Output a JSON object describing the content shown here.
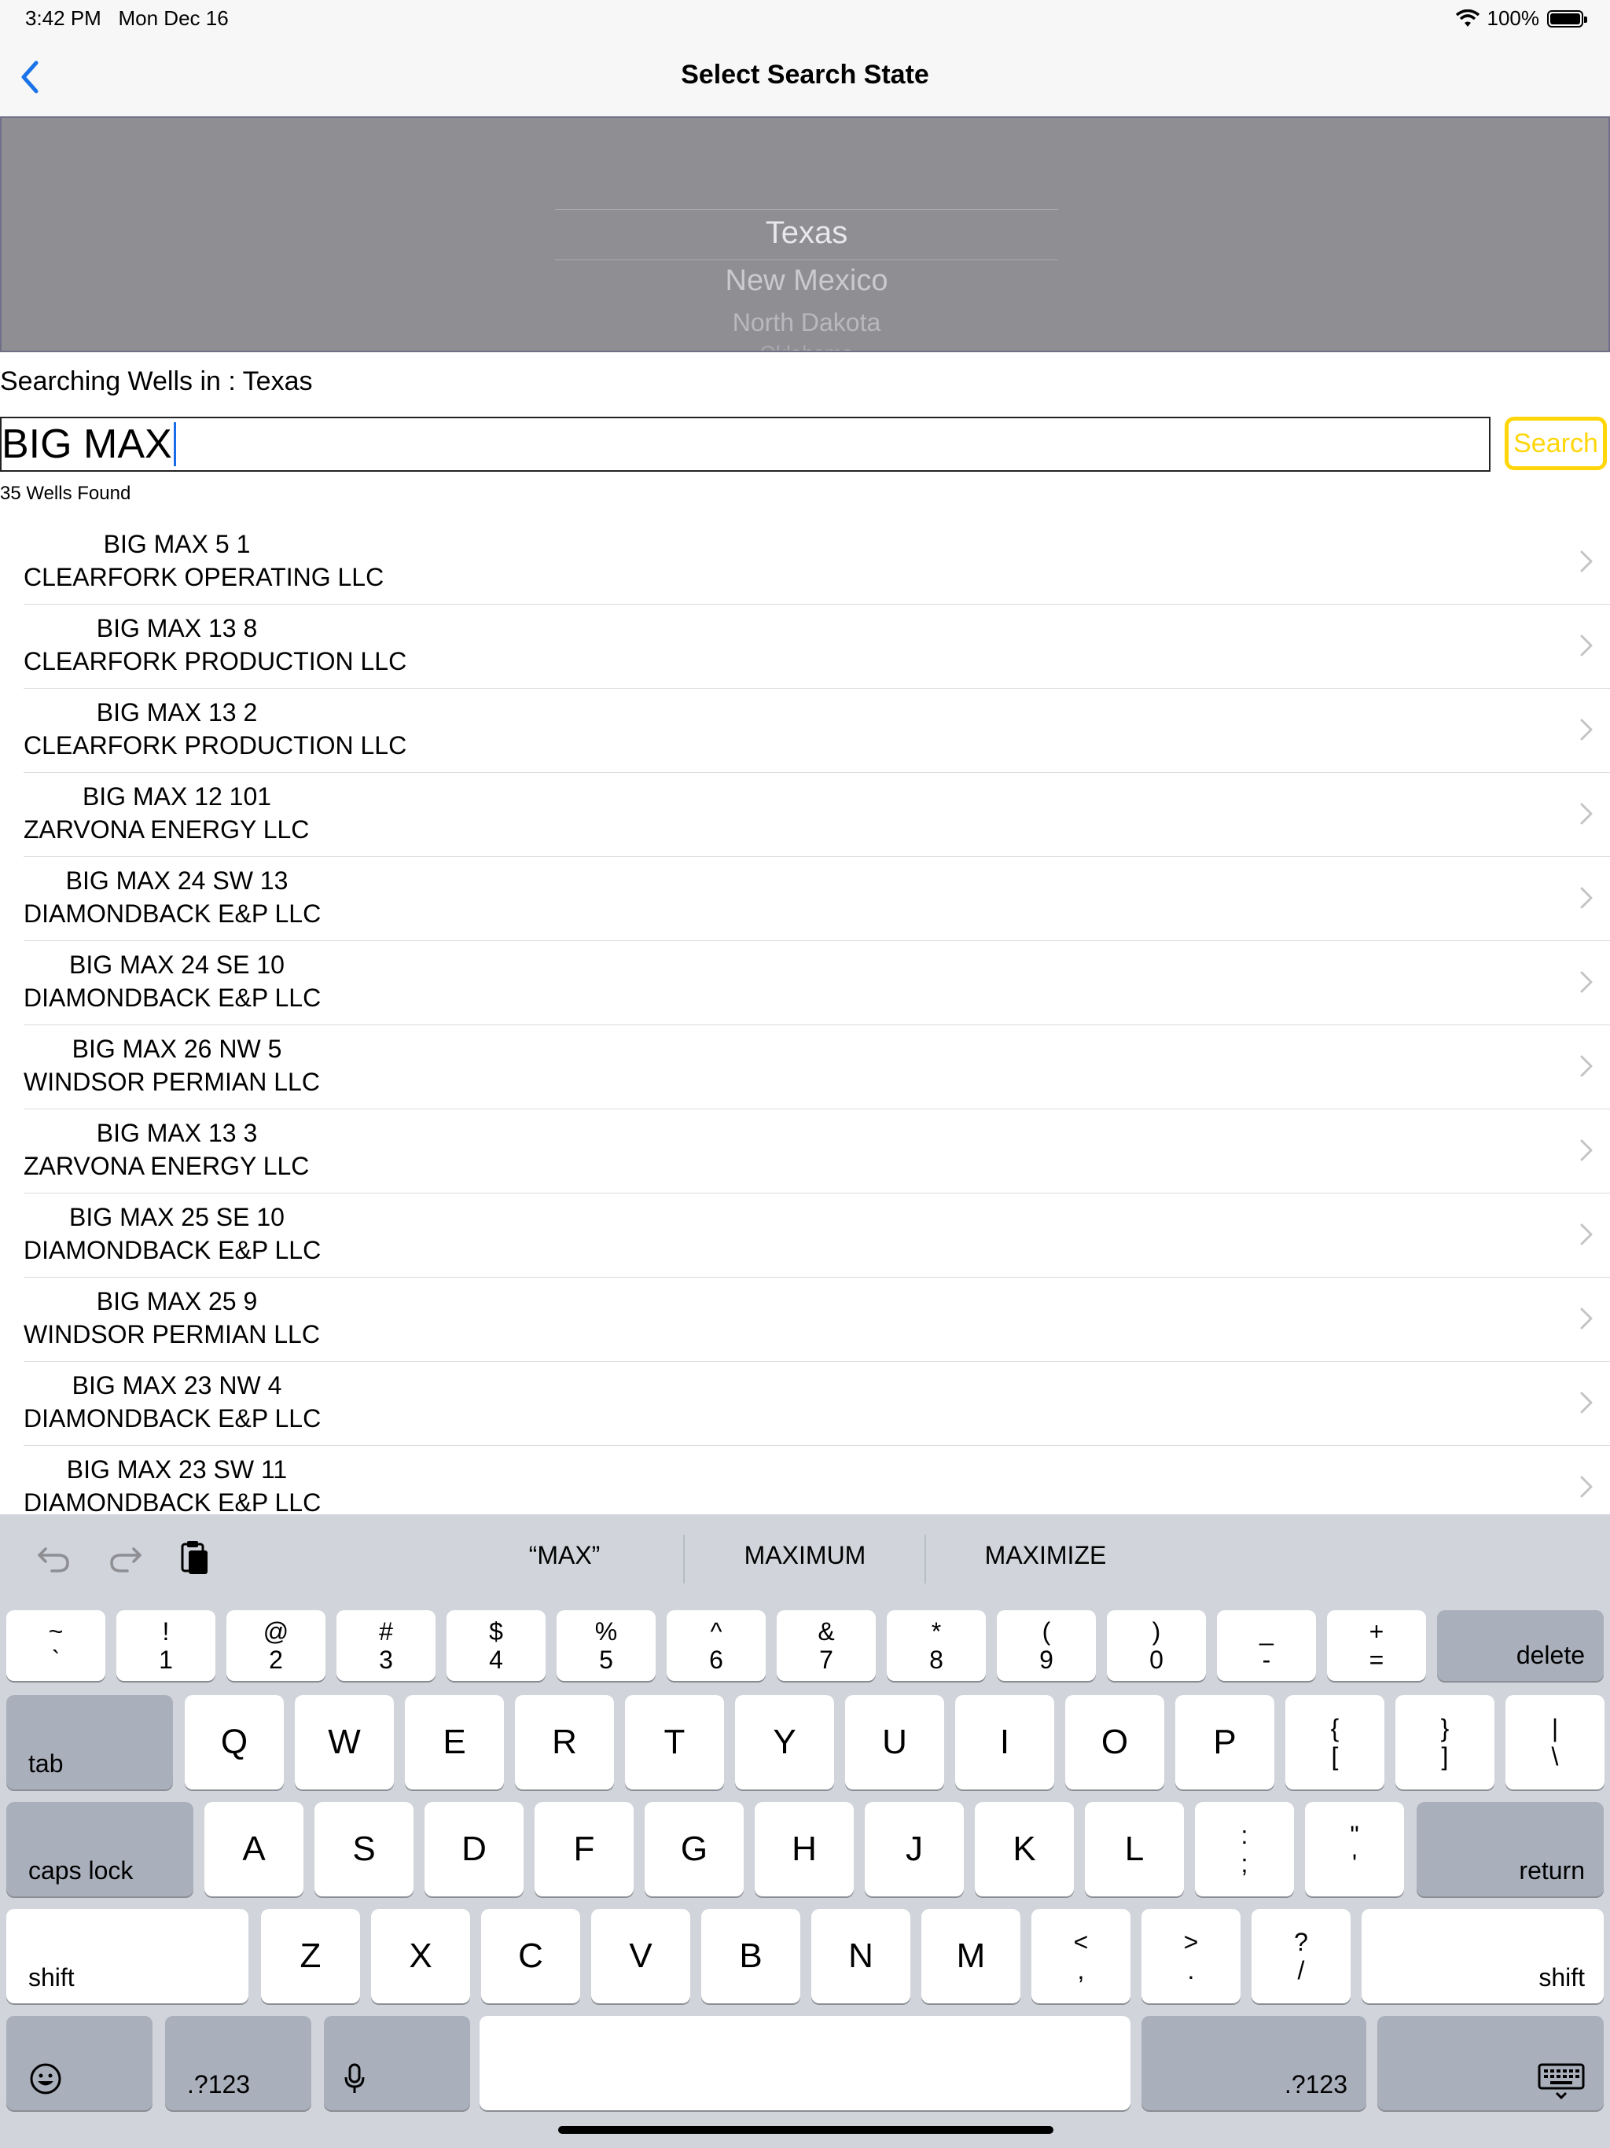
{
  "status": {
    "time": "3:42 PM",
    "date": "Mon Dec 16",
    "battery": "100%"
  },
  "nav": {
    "title": "Select Search State"
  },
  "picker": {
    "selected": "Texas",
    "options": [
      "New Mexico",
      "North Dakota",
      "Oklahoma"
    ]
  },
  "search": {
    "state_label": "Searching Wells in : Texas",
    "query": "BIG MAX",
    "button": "Search",
    "count": "35 Wells Found"
  },
  "wells": [
    {
      "name": "BIG MAX 5 1",
      "operator": "CLEARFORK OPERATING LLC"
    },
    {
      "name": "BIG MAX 13 8",
      "operator": "CLEARFORK PRODUCTION LLC"
    },
    {
      "name": "BIG MAX 13 2",
      "operator": "CLEARFORK PRODUCTION LLC"
    },
    {
      "name": "BIG MAX 12 101",
      "operator": "ZARVONA ENERGY LLC"
    },
    {
      "name": "BIG MAX 24 SW 13",
      "operator": "DIAMONDBACK E&P LLC"
    },
    {
      "name": "BIG MAX 24 SE 10",
      "operator": "DIAMONDBACK E&P LLC"
    },
    {
      "name": "BIG MAX 26 NW 5",
      "operator": "WINDSOR PERMIAN LLC"
    },
    {
      "name": "BIG MAX 13 3",
      "operator": "ZARVONA ENERGY LLC"
    },
    {
      "name": "BIG MAX 25 SE 10",
      "operator": "DIAMONDBACK E&P LLC"
    },
    {
      "name": "BIG MAX 25 9",
      "operator": "WINDSOR PERMIAN LLC"
    },
    {
      "name": "BIG MAX 23 NW 4",
      "operator": "DIAMONDBACK E&P LLC"
    },
    {
      "name": "BIG MAX 23 SW 11",
      "operator": "DIAMONDBACK E&P LLC"
    }
  ],
  "keyboard": {
    "suggestions": [
      "“MAX”",
      "MAXIMUM",
      "MAXIMIZE"
    ],
    "row1": [
      [
        "~",
        "`"
      ],
      [
        "!",
        "1"
      ],
      [
        "@",
        "2"
      ],
      [
        "#",
        "3"
      ],
      [
        "$",
        "4"
      ],
      [
        "%",
        "5"
      ],
      [
        "^",
        "6"
      ],
      [
        "&",
        "7"
      ],
      [
        "*",
        "8"
      ],
      [
        "(",
        "9"
      ],
      [
        ")",
        "0"
      ],
      [
        "_",
        "-"
      ],
      [
        "+",
        "="
      ]
    ],
    "delete": "delete",
    "tab": "tab",
    "row2": [
      "Q",
      "W",
      "E",
      "R",
      "T",
      "Y",
      "U",
      "I",
      "O",
      "P"
    ],
    "row2_sym": [
      [
        "{",
        "["
      ],
      [
        "}",
        "]"
      ],
      [
        "|",
        "\\"
      ]
    ],
    "caps": "caps lock",
    "row3": [
      "A",
      "S",
      "D",
      "F",
      "G",
      "H",
      "J",
      "K",
      "L"
    ],
    "row3_sym": [
      [
        ":",
        ";"
      ],
      [
        "\"",
        "'"
      ]
    ],
    "return": "return",
    "shift": "shift",
    "row4": [
      "Z",
      "X",
      "C",
      "V",
      "B",
      "N",
      "M"
    ],
    "row4_sym": [
      [
        "<",
        ","
      ],
      [
        ">",
        "."
      ],
      [
        "?",
        "/"
      ]
    ],
    "num": ".?123"
  }
}
